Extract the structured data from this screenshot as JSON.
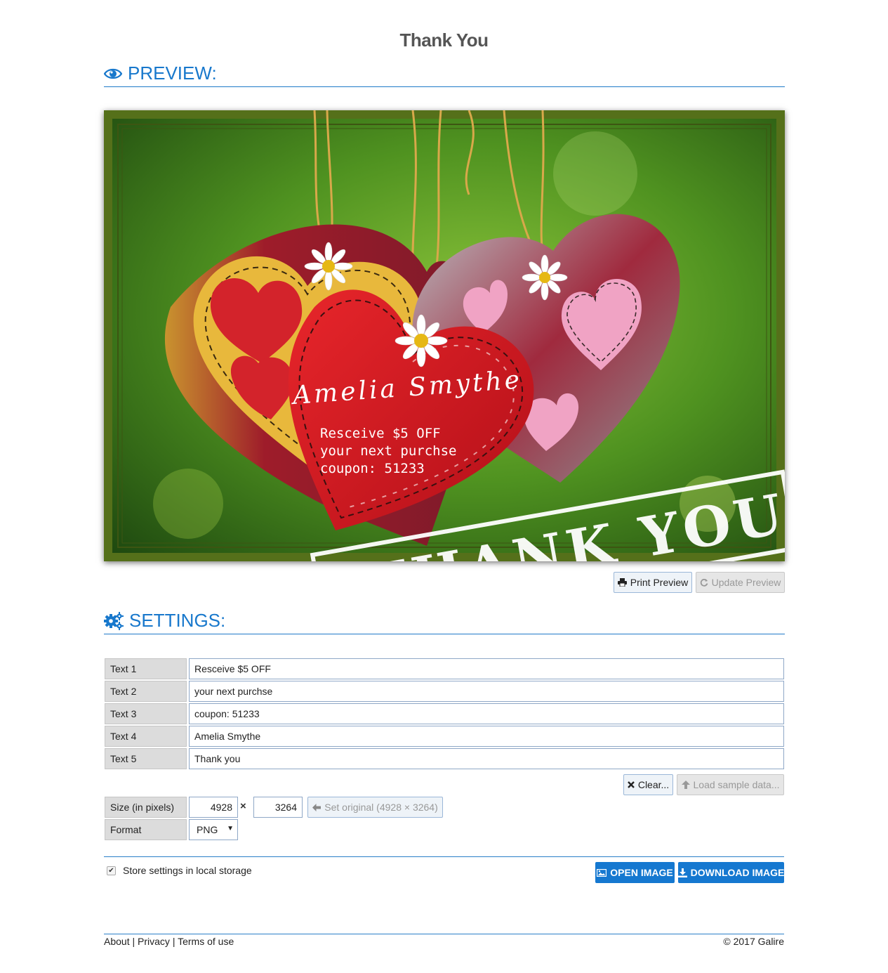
{
  "page": {
    "title": "Thank You"
  },
  "preview": {
    "heading": "PREVIEW:",
    "card": {
      "name_text": "Amelia Smythe",
      "lines": [
        "Resceive $5 OFF",
        "your next purchse",
        "coupon: 51233"
      ],
      "stamp_text": "THANK YOU"
    },
    "print_label": "Print Preview",
    "update_label": "Update Preview"
  },
  "settings": {
    "heading": "SETTINGS:",
    "rows": [
      {
        "label": "Text 1",
        "value": "Resceive $5 OFF"
      },
      {
        "label": "Text 2",
        "value": "your next purchse"
      },
      {
        "label": "Text 3",
        "value": "coupon: 51233"
      },
      {
        "label": "Text 4",
        "value": "Amelia Smythe"
      },
      {
        "label": "Text 5",
        "value": "Thank you"
      }
    ],
    "clear_label": "Clear...",
    "load_sample_label": "Load sample data...",
    "size_label": "Size (in pixels)",
    "width": "4928",
    "height": "3264",
    "times_symbol": "×",
    "set_original_label": "Set original (4928 × 3264)",
    "format_label": "Format",
    "format_value": "PNG",
    "store_label": "Store settings in local storage",
    "store_checked": true,
    "open_image_label": "OPEN IMAGE",
    "download_image_label": "DOWNLOAD IMAGE"
  },
  "footer": {
    "links": [
      "About",
      "Privacy",
      "Terms of use"
    ],
    "separator": "|",
    "copyright": "© 2017 Galire"
  },
  "colors": {
    "accent": "#1878cc",
    "primary_button": "#1578d0",
    "frame_green": "#55701a"
  },
  "icons": {
    "preview": "eye-icon",
    "settings": "gears-icon",
    "print": "print-icon",
    "update": "refresh-icon",
    "clear": "x-icon",
    "load_sample": "arrow-up-icon",
    "set_original": "arrow-left-icon",
    "open_image": "image-icon",
    "download_image": "download-icon"
  }
}
